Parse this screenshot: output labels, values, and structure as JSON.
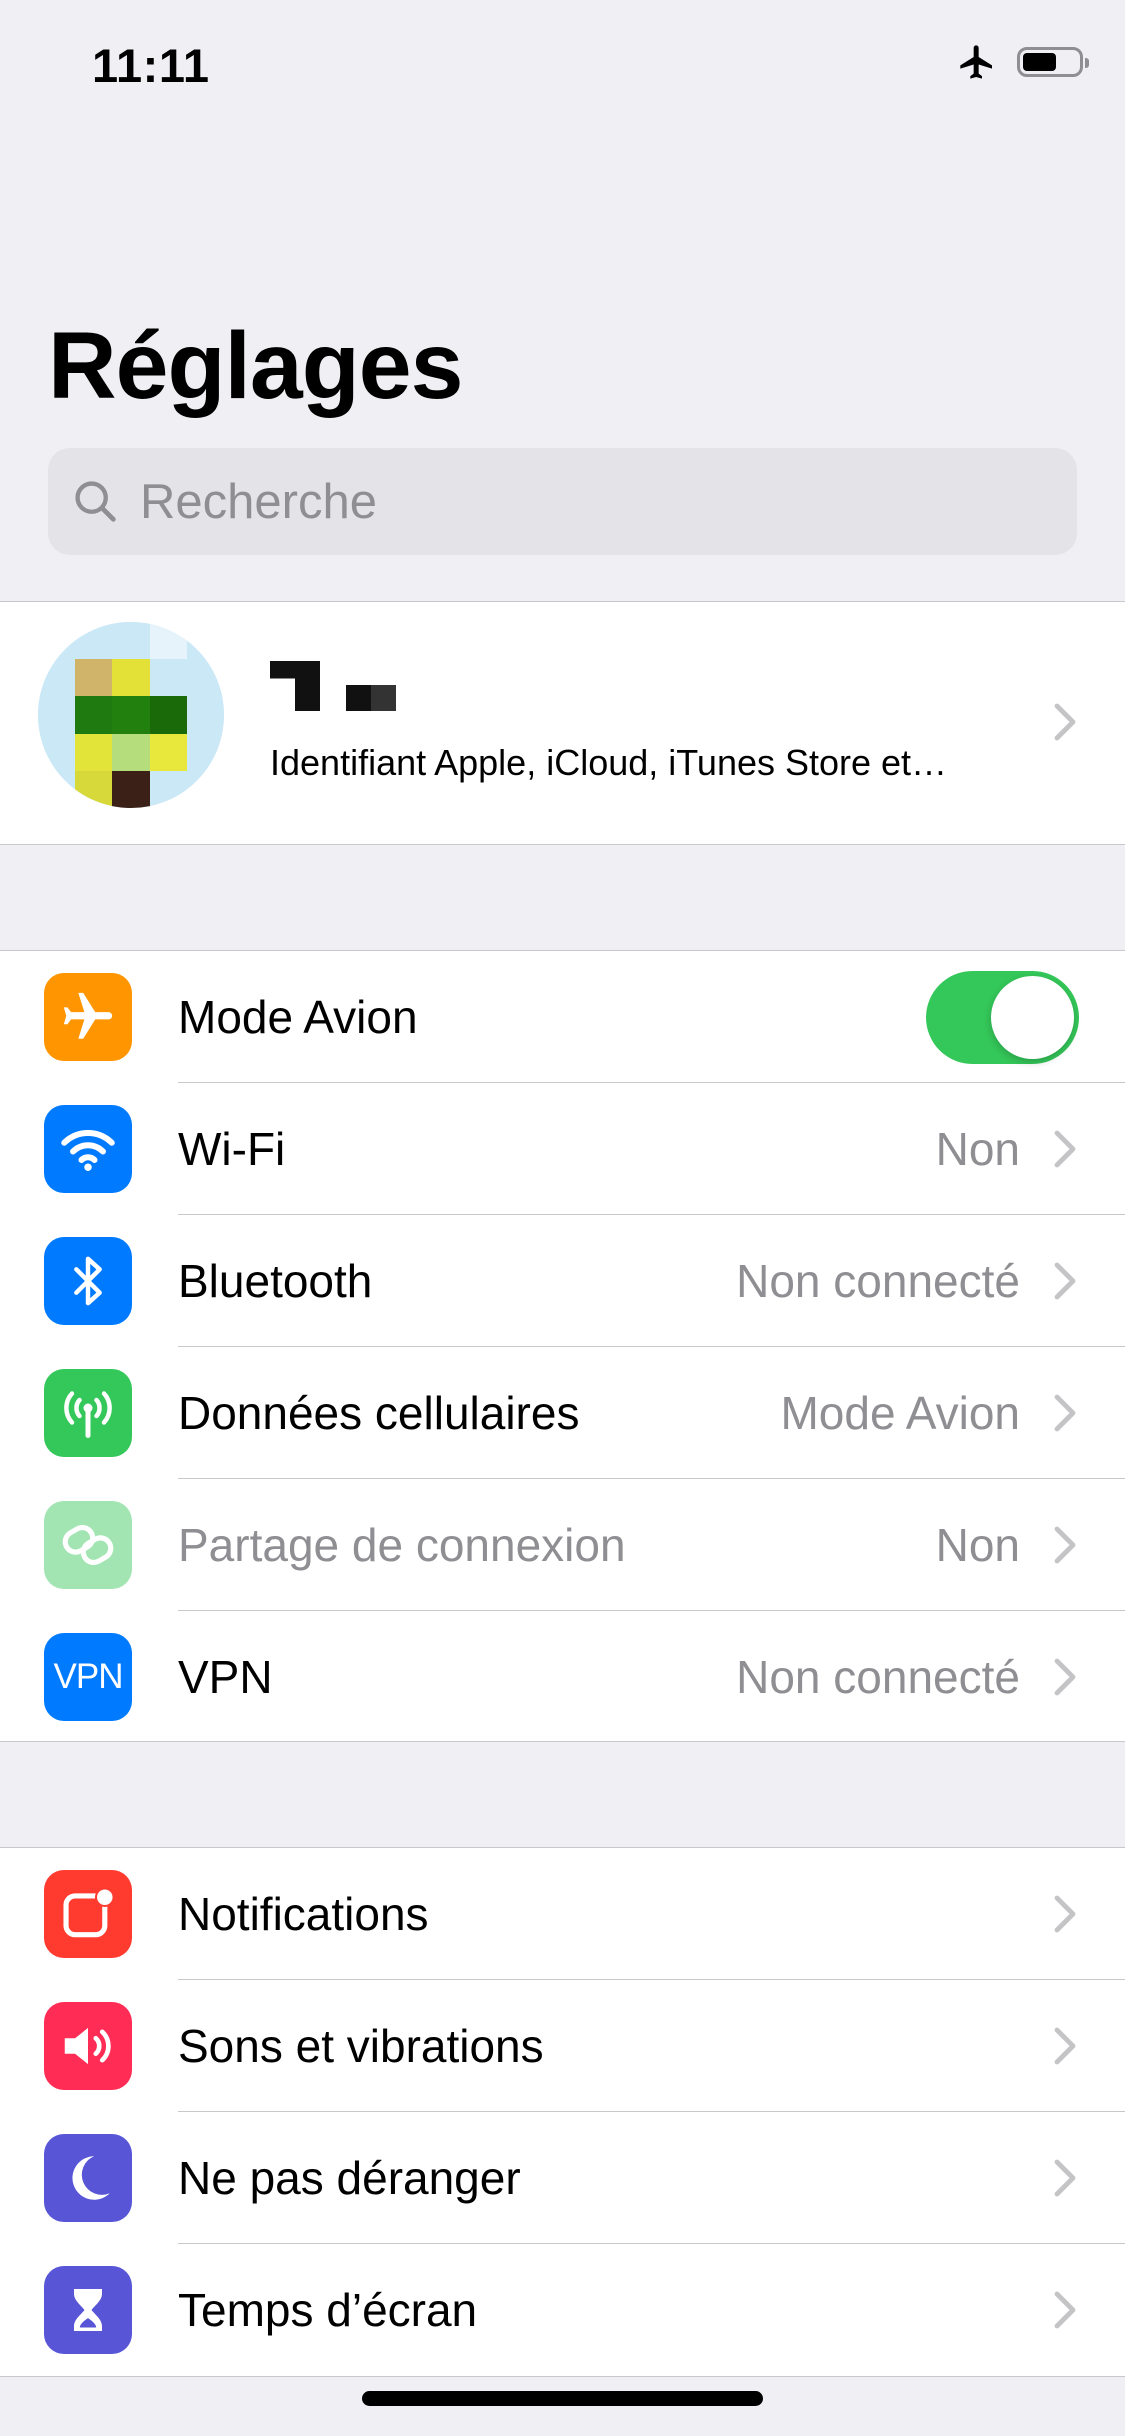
{
  "status_bar": {
    "time": "11:11",
    "icons": [
      "airplane-icon",
      "battery-icon"
    ]
  },
  "title": "Réglages",
  "search": {
    "placeholder": "Recherche"
  },
  "profile": {
    "subtitle": "Identifiant Apple, iCloud, iTunes Store et…"
  },
  "network_section": [
    {
      "label": "Mode Avion",
      "value": "",
      "icon": "airplane-icon",
      "icon_color": "#ff9500",
      "control": "toggle",
      "toggle_on": true
    },
    {
      "label": "Wi-Fi",
      "value": "Non",
      "icon": "wifi-icon",
      "icon_color": "#007aff"
    },
    {
      "label": "Bluetooth",
      "value": "Non connecté",
      "icon": "bluetooth-icon",
      "icon_color": "#007aff"
    },
    {
      "label": "Données cellulaires",
      "value": "Mode Avion",
      "icon": "cellular-antenna-icon",
      "icon_color": "#34c759"
    },
    {
      "label": "Partage de connexion",
      "value": "Non",
      "icon": "hotspot-chain-icon",
      "icon_color": "#a2e5b3",
      "disabled": true
    },
    {
      "label": "VPN",
      "value": "Non connecté",
      "icon": "vpn-icon",
      "icon_text": "VPN",
      "icon_color": "#007aff"
    }
  ],
  "system_section": [
    {
      "label": "Notifications",
      "icon": "notifications-icon",
      "icon_color": "#ff3b30"
    },
    {
      "label": "Sons et vibrations",
      "icon": "speaker-icon",
      "icon_color": "#ff2d55"
    },
    {
      "label": "Ne pas déranger",
      "icon": "moon-icon",
      "icon_color": "#5856d6"
    },
    {
      "label": "Temps d’écran",
      "icon": "hourglass-icon",
      "icon_color": "#5856d6"
    }
  ],
  "colors": {
    "background": "#efeff4",
    "separator": "#c8c7cc",
    "secondary_text": "#8e8e93",
    "toggle_on": "#34c759"
  }
}
